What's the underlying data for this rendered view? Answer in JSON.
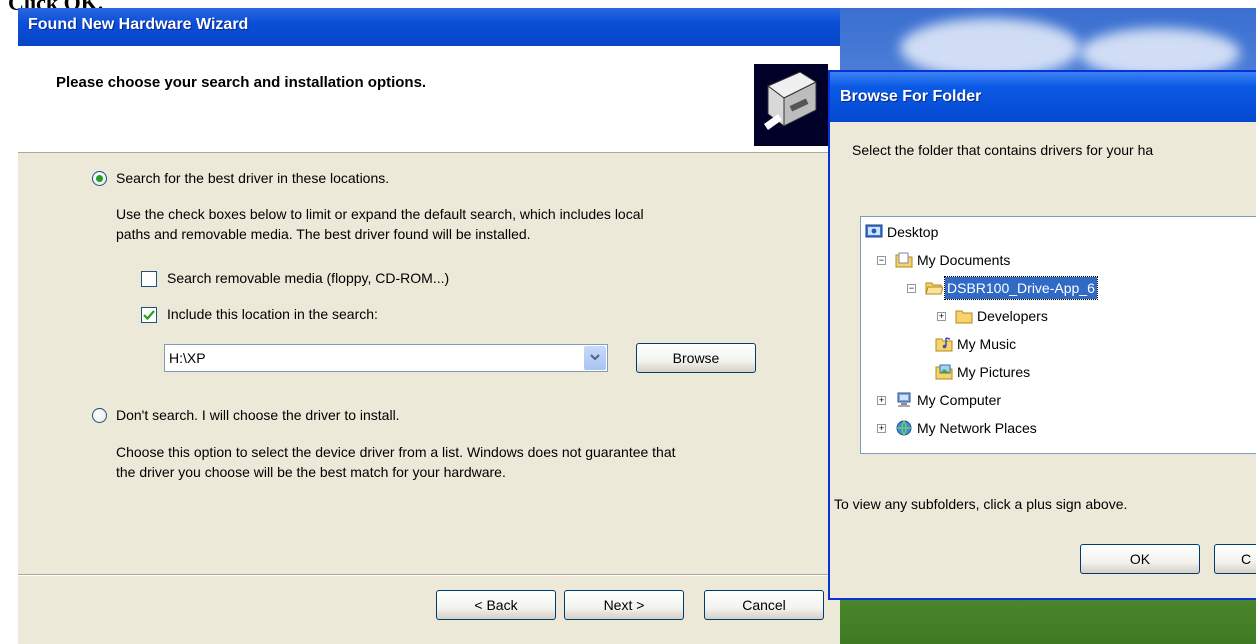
{
  "caption": "Click OK.",
  "wizard": {
    "title": "Found New Hardware Wizard",
    "header": "Please choose your search and installation options.",
    "option_search_label": "Search for the best driver in these locations.",
    "option_search_desc_1": "Use the check boxes below to limit or expand the default search, which includes local",
    "option_search_desc_2": "paths and removable media. The best driver found will be installed.",
    "check_removable_label": "Search removable media (floppy, CD-ROM...)",
    "check_include_label": "Include this location in the search:",
    "location_value": "H:\\XP",
    "browse_button": "Browse",
    "option_dont_search_label": "Don't search. I will choose the driver to install.",
    "option_dont_desc_1": "Choose this option to select the device driver from a list.  Windows does not guarantee that",
    "option_dont_desc_2": "the driver you choose will be the best match for your hardware.",
    "back_button": "< Back",
    "next_button": "Next >",
    "cancel_button": "Cancel"
  },
  "browse_dialog": {
    "title": "Browse For Folder",
    "instruction": "Select the folder that contains drivers for your ha",
    "tree": [
      {
        "label": "Desktop"
      },
      {
        "label": "My Documents"
      },
      {
        "label": "DSBR100_Drive-App_6"
      },
      {
        "label": "Developers"
      },
      {
        "label": "My Music"
      },
      {
        "label": "My Pictures"
      },
      {
        "label": "My Computer"
      },
      {
        "label": "My Network Places"
      }
    ],
    "hint": "To view any subfolders, click a plus sign above.",
    "ok_button": "OK",
    "cancel_button_partial": "C"
  },
  "colors": {
    "xp_title_blue": "#0a4fd8",
    "selection_blue": "#316ac5",
    "dialog_face": "#ece9d8"
  }
}
